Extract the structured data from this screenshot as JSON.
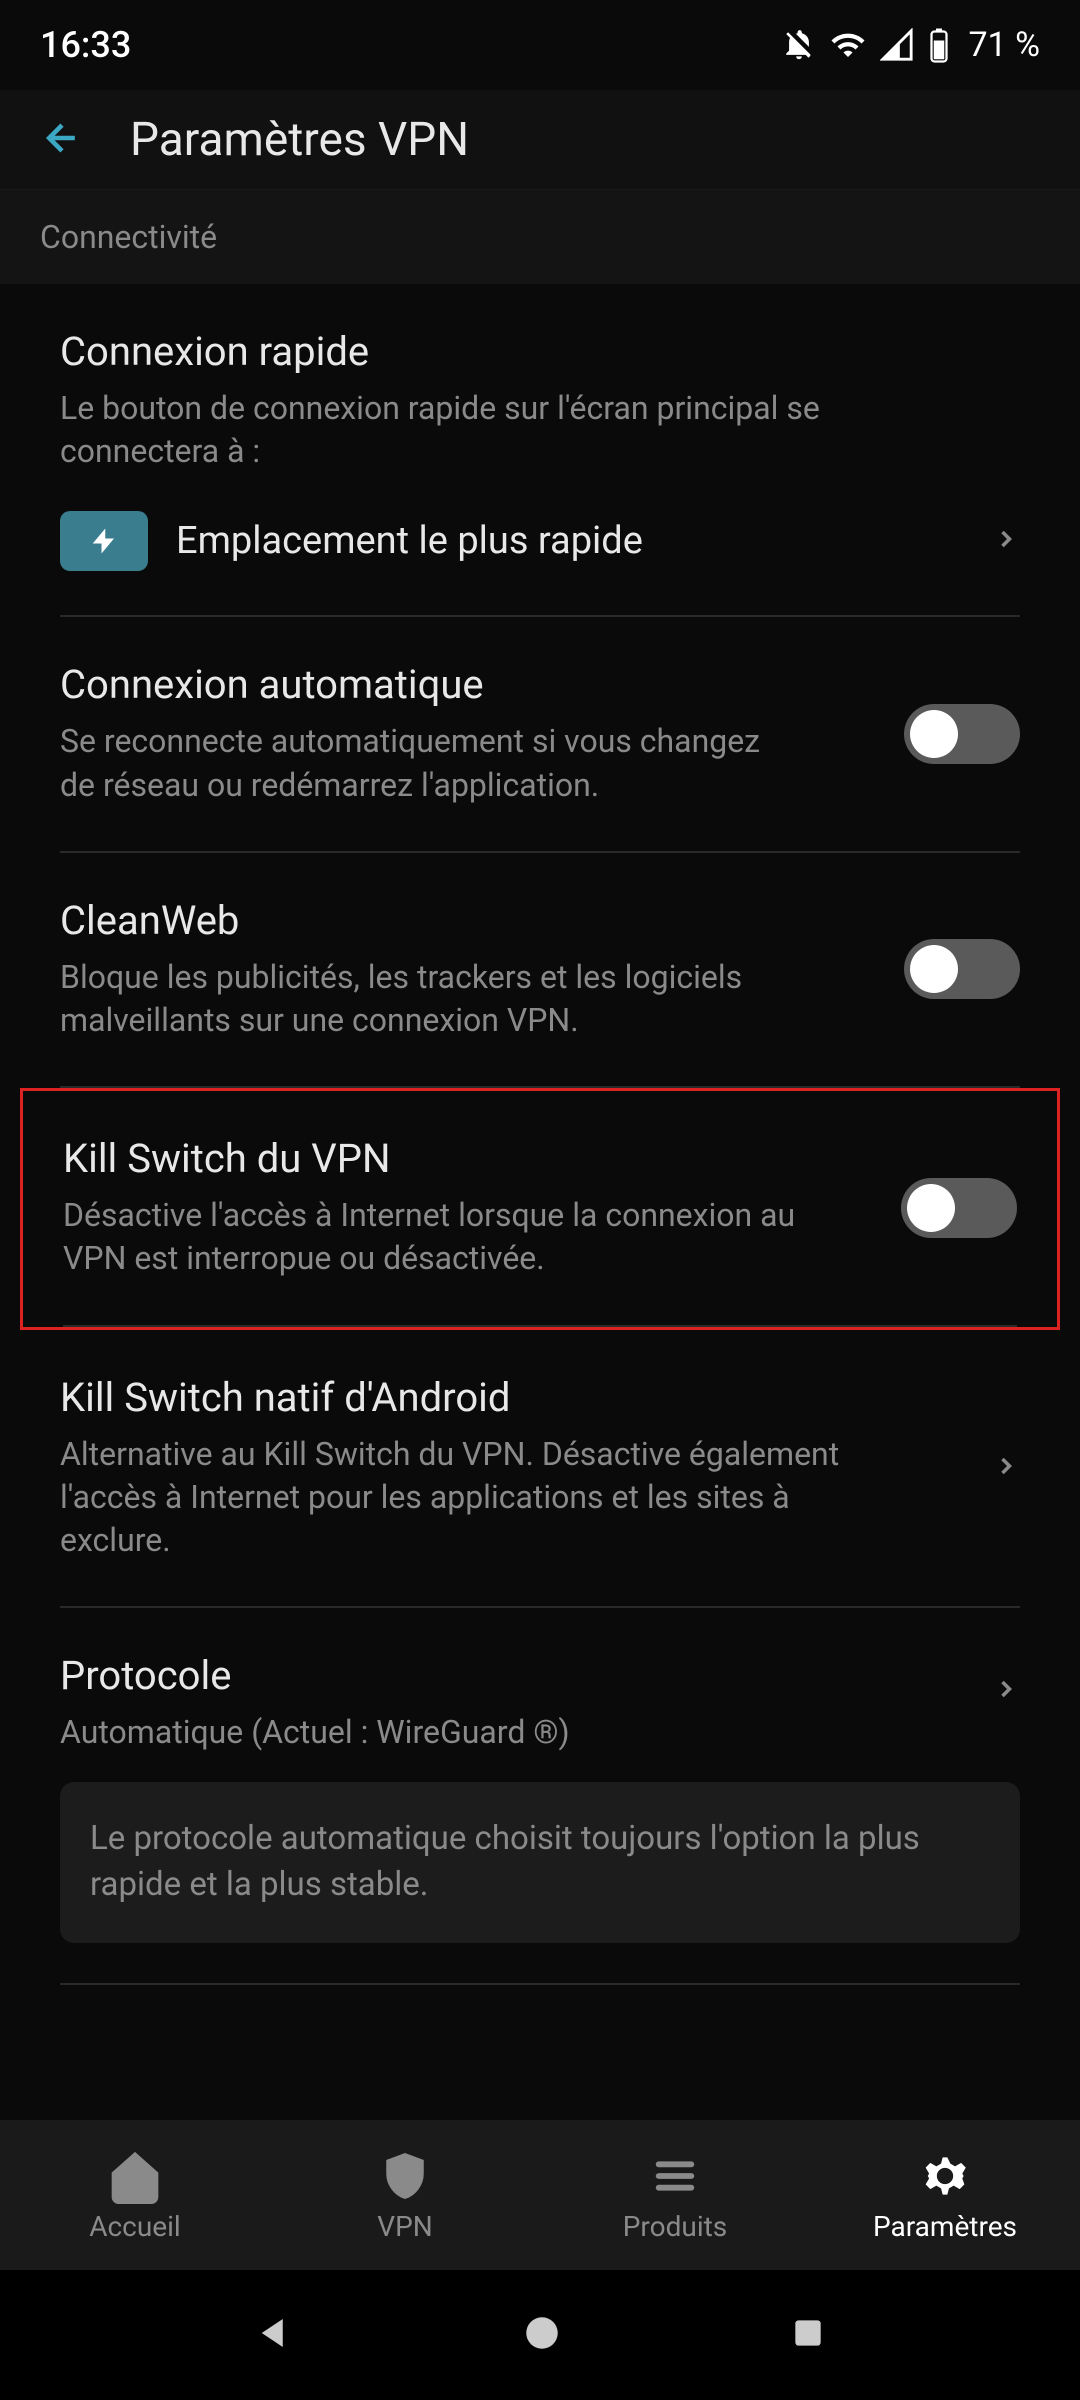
{
  "status": {
    "time": "16:33",
    "battery": "71 %"
  },
  "header": {
    "title": "Paramètres VPN"
  },
  "section": {
    "connectivity": "Connectivité"
  },
  "settings": {
    "quick_connect": {
      "title": "Connexion rapide",
      "desc": "Le bouton de connexion rapide sur l'écran principal se connectera à :",
      "value": "Emplacement le plus rapide"
    },
    "auto_connect": {
      "title": "Connexion automatique",
      "desc": "Se reconnecte automatiquement si vous changez de réseau ou redémarrez l'application."
    },
    "cleanweb": {
      "title": "CleanWeb",
      "desc": "Bloque les publicités, les trackers et les logiciels malveillants sur une connexion VPN."
    },
    "kill_switch": {
      "title": "Kill Switch du VPN",
      "desc": "Désactive l'accès à Internet lorsque la connexion au VPN est interropue ou désactivée."
    },
    "native_kill": {
      "title": "Kill Switch natif d'Android",
      "desc": "Alternative au Kill Switch du VPN. Désactive également l'accès à Internet pour les applications et les sites à exclure."
    },
    "protocol": {
      "title": "Protocole",
      "desc": "Automatique (Actuel : WireGuard ®)",
      "info": "Le protocole automatique choisit toujours l'option la plus rapide et la plus stable."
    }
  },
  "nav": {
    "home": "Accueil",
    "vpn": "VPN",
    "products": "Produits",
    "settings": "Paramètres"
  }
}
